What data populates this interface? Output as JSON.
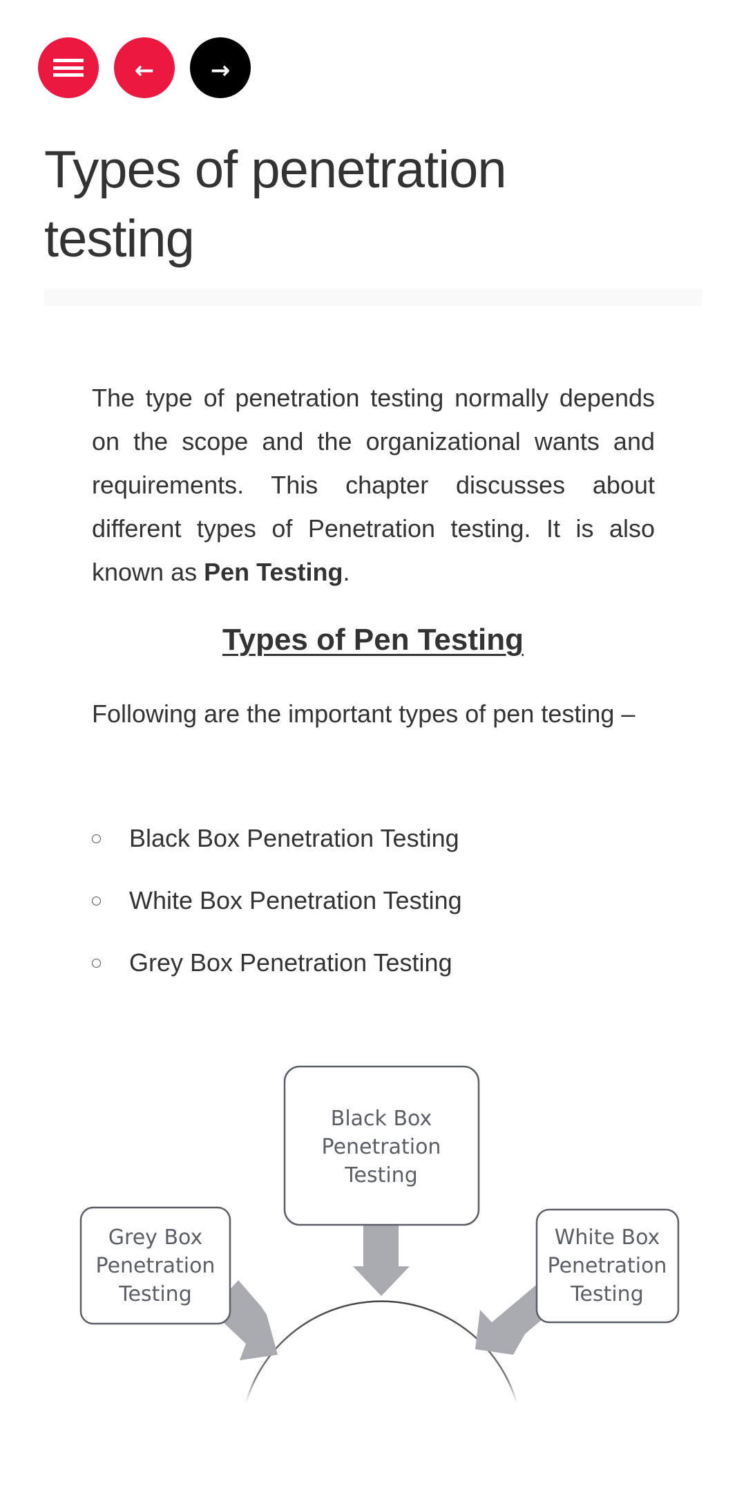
{
  "nav": {
    "menu_icon": "hamburger-menu-icon",
    "prev_icon": "arrow-left-icon",
    "prev_glyph": "←",
    "next_icon": "arrow-right-icon",
    "next_glyph": "→",
    "colors": {
      "accent": "#ec1840",
      "dark": "#000000"
    }
  },
  "page": {
    "title": "Types of penetration testing"
  },
  "intro": {
    "text_before": "The type of penetration testing normally depends on the scope and the organizational wants and requirements. This chapter discusses about different types of Penetration testing. It is also known as ",
    "bold": "Pen Testing",
    "text_after": "."
  },
  "section": {
    "heading": "Types of Pen Testing",
    "lead": "Following are the important types of pen testing –",
    "items": [
      {
        "label": "Black Box Penetration Testing"
      },
      {
        "label": "White Box Penetration Testing"
      },
      {
        "label": "Grey Box Penetration Testing"
      }
    ]
  },
  "diagram": {
    "boxes": [
      {
        "name": "black-box",
        "lines": [
          "Black Box",
          "Penetration",
          "Testing"
        ]
      },
      {
        "name": "grey-box",
        "lines": [
          "Grey Box",
          "Penetration",
          "Testing"
        ]
      },
      {
        "name": "white-box",
        "lines": [
          "White Box",
          "Penetration",
          "Testing"
        ]
      }
    ],
    "colors": {
      "arrow": "#a9abb0",
      "border": "#5a5e66"
    }
  }
}
